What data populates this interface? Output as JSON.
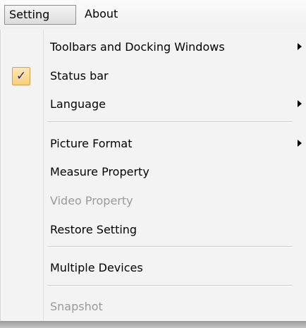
{
  "menubar": {
    "items": [
      {
        "label": "Setting",
        "active": true
      },
      {
        "label": "About",
        "active": false
      }
    ]
  },
  "dropdown": {
    "items": [
      {
        "label": "Toolbars and Docking Windows",
        "has_submenu": true,
        "enabled": true
      },
      {
        "label": "Status bar",
        "checked": true,
        "check_glyph": "✓",
        "enabled": true
      },
      {
        "label": "Language",
        "has_submenu": true,
        "enabled": true
      },
      {
        "label": "Picture Format",
        "has_submenu": true,
        "enabled": true
      },
      {
        "label": "Measure Property",
        "enabled": true
      },
      {
        "label": "Video Property",
        "enabled": false
      },
      {
        "label": "Restore Setting",
        "enabled": true
      },
      {
        "label": "Multiple Devices",
        "enabled": true
      },
      {
        "label": "Snapshot",
        "enabled": false
      }
    ]
  },
  "colors": {
    "menu_background": "#f3f3f3",
    "disabled_text": "#9a9a9a",
    "check_highlight": "#f8cf7c",
    "check_mark": "#1a2f8c"
  },
  "icons": {
    "submenu": "submenu-arrow-icon",
    "check": "checkmark-icon"
  }
}
